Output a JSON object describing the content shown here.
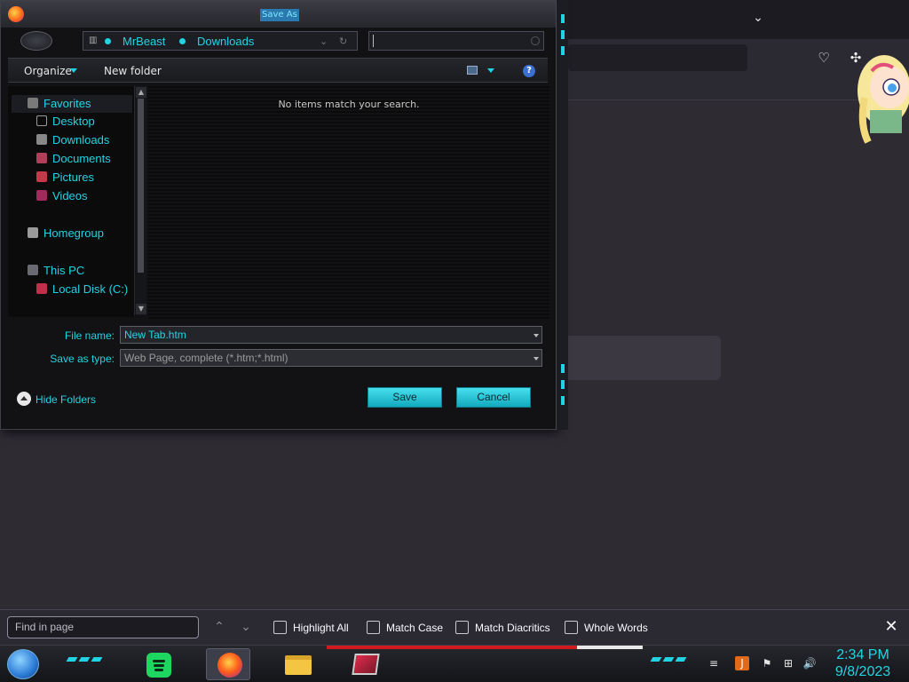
{
  "dialog": {
    "title": "Save As",
    "breadcrumb": [
      "MrBeast",
      "Downloads"
    ],
    "toolbar": {
      "organize": "Organize",
      "new_folder": "New folder",
      "help": "?"
    },
    "nav": {
      "favorites": "Favorites",
      "desktop": "Desktop",
      "downloads": "Downloads",
      "documents": "Documents",
      "pictures": "Pictures",
      "videos": "Videos",
      "homegroup": "Homegroup",
      "this_pc": "This PC",
      "local_disk": "Local Disk (C:)"
    },
    "empty_message": "No items match your search.",
    "file_name_label": "File name:",
    "file_name_value": "New Tab.htm",
    "save_type_label": "Save as type:",
    "save_type_value": "Web Page, complete (*.htm;*.html)",
    "hide_folders": "Hide Folders",
    "save_button": "Save",
    "cancel_button": "Cancel"
  },
  "findbar": {
    "placeholder": "Find in page",
    "highlight_all": "Highlight All",
    "match_case": "Match Case",
    "match_diacritics": "Match Diacritics",
    "whole_words": "Whole Words"
  },
  "taskbar": {
    "apps": [
      "spotify-icon",
      "firefox-icon",
      "file-explorer-icon",
      "tv-app-icon"
    ],
    "clock_time": "2:34 PM",
    "clock_date": "9/8/2023"
  },
  "colors": {
    "accent": "#21d4e4",
    "background": "#2e2b33",
    "dialog_bg": "#121214"
  }
}
